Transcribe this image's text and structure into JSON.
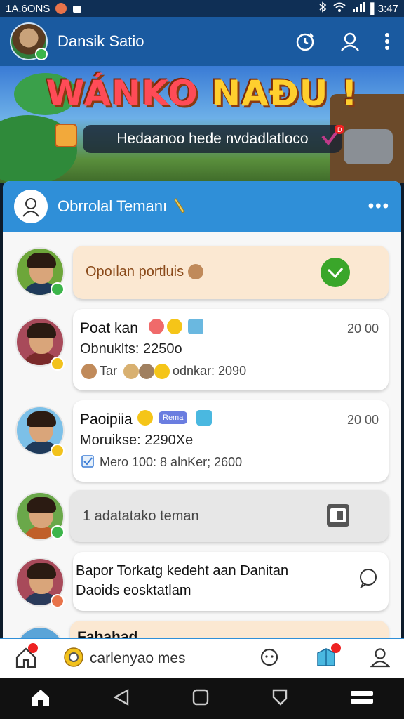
{
  "status_bar": {
    "time": "1A.6ОNS",
    "battery_text": "▌3:47"
  },
  "app_bar": {
    "title": "Dansik Satio",
    "icons": [
      "timer-icon",
      "profile-icon",
      "more-vertical-icon"
    ]
  },
  "banner": {
    "title_part1": "WÁNKO",
    "title_part2": " NAÐU !",
    "pill_text": "Hedaanoo hede nvdadlatloco"
  },
  "chat_card": {
    "title": "Obrrolal Temanı",
    "rows": [
      {
        "type": "quick",
        "text": "Opoılan portluis"
      },
      {
        "type": "message",
        "name": "Poat kan",
        "time": "20 00",
        "line2": "Obnuklts: 2250о",
        "line3_prefix": "Tar",
        "line3_suffix": "odnkar: 2090"
      },
      {
        "type": "message",
        "name": "Paoipiia",
        "tag": "Rema",
        "time": "20 00",
        "line2": "Moruikse: 2290Xe",
        "line3": "Mero 100: 8 alnKer; 2600"
      },
      {
        "type": "grey",
        "text": "1 adatatako teman"
      },
      {
        "type": "invite",
        "line1": "Bapor Torkatg kedeht aan Danitan",
        "line2": "Daoids eosktatlam"
      },
      {
        "type": "partial",
        "text": "Fabahad"
      }
    ]
  },
  "bottom_nav": {
    "search_label": "carlenyao mes"
  },
  "colors": {
    "primary": "#1a5aa0",
    "header": "#2f8fd8",
    "accent_green": "#3cb54a",
    "peach": "#fbe8d2"
  }
}
